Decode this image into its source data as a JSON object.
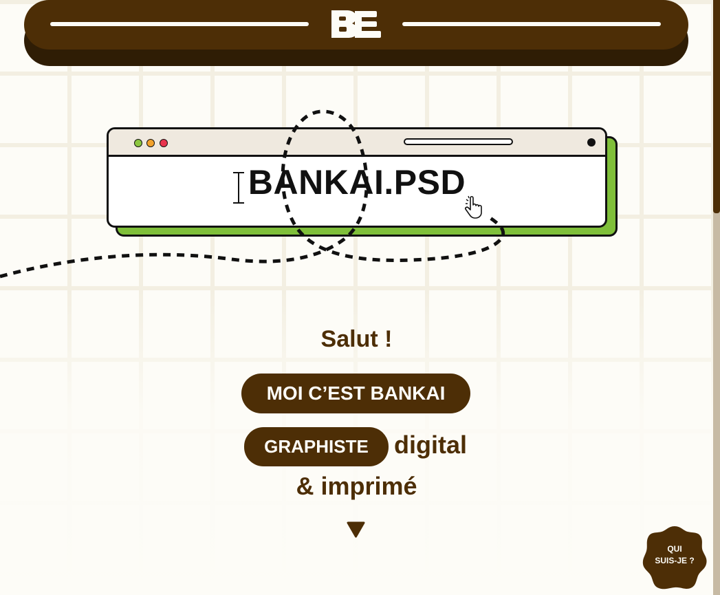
{
  "header": {
    "logo_text": "BE"
  },
  "hero": {
    "window_title": "BANKAI.PSD",
    "greeting": "Salut !",
    "name_pill": "MOI C’EST BANKAI",
    "role_pill": "GRAPHISTE",
    "role_suffix": "digital",
    "role_line2": "& imprimé"
  },
  "floating_button": {
    "line1": "QUI",
    "line2": "SUIS-JE ?"
  },
  "icons": {
    "scroll_down": "triangle-down-icon",
    "text_cursor": "i-beam-cursor-icon",
    "hand_cursor": "hand-pointer-icon"
  },
  "colors": {
    "brand_brown": "#4d2e06",
    "background": "#fdfcf7",
    "accent_green": "#7fbf3a",
    "dot_green": "#8cc63f",
    "dot_orange": "#f2a22c",
    "dot_red": "#e8344e"
  }
}
